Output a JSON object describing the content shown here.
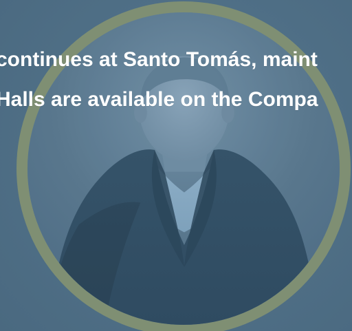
{
  "overlay": {
    "caption_lines": [
      "continues at Santo Tomás, maint",
      "Halls are available on the Compa"
    ]
  },
  "portrait": {
    "ring_color": "#7f8f73",
    "tint_color": "#4f6f86"
  }
}
